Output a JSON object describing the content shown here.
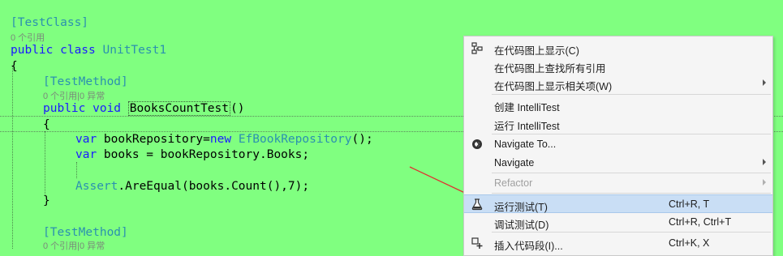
{
  "code": {
    "attr_class": "[TestClass]",
    "lens_class": "0 个引用",
    "class_kw": "public class ",
    "class_name": "UnitTest1",
    "brace_open": "{",
    "attr_method": "[TestMethod]",
    "lens_method": "0 个引用|0 异常",
    "method_kw": "public void ",
    "method_name": "BooksCountTest",
    "method_paren": "()",
    "inner_brace_open": "{",
    "line1_var": "var",
    "line1_mid": " bookRepository=",
    "line1_new": "new",
    "line1_type": " EfBookRepository",
    "line1_end": "();",
    "line2_var": "var",
    "line2_rest": " books = bookRepository.Books;",
    "line3_assert": "Assert",
    "line3_rest": ".AreEqual(books.Count(),7);",
    "inner_brace_close": "}",
    "attr_method2": "[TestMethod]",
    "lens_method2": "0 个引用|0 异常"
  },
  "menu": {
    "items": [
      {
        "label": "在代码图上显示(C)",
        "icon": "code-map-icon"
      },
      {
        "label": "在代码图上查找所有引用"
      },
      {
        "label": "在代码图上显示相关项(W)",
        "submenu": true
      },
      {
        "label": "创建 IntelliTest"
      },
      {
        "label": "运行 IntelliTest"
      },
      {
        "label": "Navigate To...",
        "icon": "navigate-icon"
      },
      {
        "label": "Navigate",
        "submenu": true
      },
      {
        "label": "Refactor",
        "submenu": true,
        "disabled": true
      },
      {
        "label": "运行测试(T)",
        "shortcut": "Ctrl+R, T",
        "icon": "run-test-icon",
        "selected": true
      },
      {
        "label": "调试测试(D)",
        "shortcut": "Ctrl+R, Ctrl+T"
      },
      {
        "label": "插入代码段(I)...",
        "shortcut": "Ctrl+K, X",
        "icon": "snippet-icon"
      }
    ]
  },
  "colors": {
    "background": "#80ff80",
    "keyword": "#1a1aff",
    "type": "#2b91af",
    "arrow": "#e03030",
    "menu_selected": "#c9def5"
  }
}
